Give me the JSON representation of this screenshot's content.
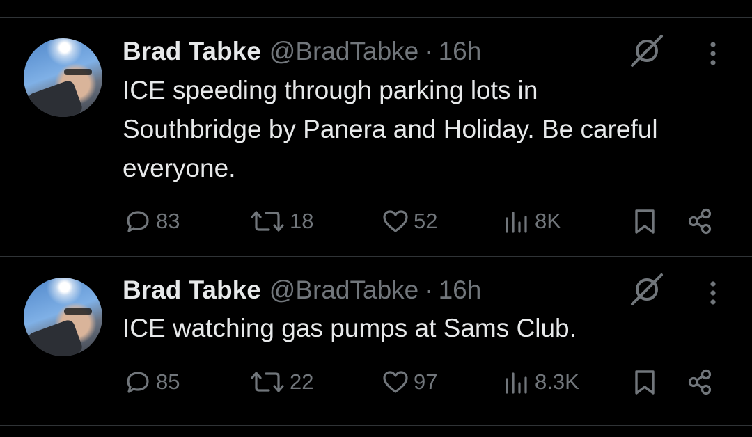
{
  "colors": {
    "background": "#000000",
    "text": "#e7e9ea",
    "muted": "#71767b",
    "divider": "#2f3336"
  },
  "tweets": [
    {
      "author_name": "Brad Tabke",
      "handle": "@BradTabke",
      "separator": "·",
      "time": "16h",
      "text": "ICE speeding through parking lots in Southbridge by Panera and Holiday. Be careful everyone.",
      "replies": "83",
      "reposts": "18",
      "likes": "52",
      "views": "8K"
    },
    {
      "author_name": "Brad Tabke",
      "handle": "@BradTabke",
      "separator": "·",
      "time": "16h",
      "text": "ICE watching gas pumps at Sams Club.",
      "replies": "85",
      "reposts": "22",
      "likes": "97",
      "views": "8.3K"
    }
  ],
  "icons": [
    "grok-icon",
    "more-options-icon",
    "reply-icon",
    "repost-icon",
    "like-icon",
    "views-icon",
    "bookmark-icon",
    "share-icon"
  ]
}
